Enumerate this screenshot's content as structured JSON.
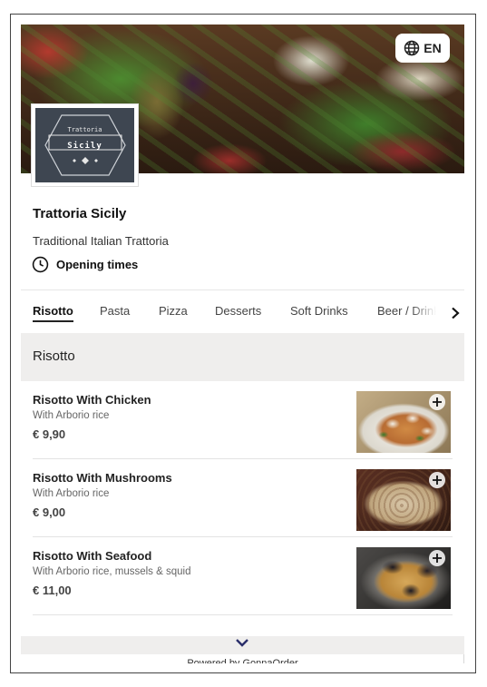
{
  "header": {
    "language_label": "EN",
    "globe_icon": "globe-icon"
  },
  "logo": {
    "top_text": "Trattoria",
    "main_text": "Sicily"
  },
  "restaurant": {
    "name": "Trattoria Sicily",
    "description": "Traditional Italian Trattoria",
    "opening_label": "Opening times",
    "opening_icon": "clock-icon"
  },
  "tabs": [
    {
      "label": "Risotto",
      "active": true
    },
    {
      "label": "Pasta",
      "active": false
    },
    {
      "label": "Pizza",
      "active": false
    },
    {
      "label": "Desserts",
      "active": false
    },
    {
      "label": "Soft Drinks",
      "active": false
    },
    {
      "label": "Beer / Drink",
      "active": false
    }
  ],
  "section": {
    "title": "Risotto"
  },
  "items": [
    {
      "name": "Risotto With Chicken",
      "description": "With Arborio rice",
      "price": "€ 9,90"
    },
    {
      "name": "Risotto With Mushrooms",
      "description": "With Arborio rice",
      "price": "€ 9,00"
    },
    {
      "name": "Risotto With Seafood",
      "description": "With Arborio rice, mussels & squid",
      "price": "€ 11,00"
    }
  ],
  "footer": {
    "powered_by": "Powered by GonnaOrder"
  },
  "colors": {
    "section_bg": "#efeeed",
    "logo_bg": "#3e4651",
    "text_primary": "#222222"
  }
}
